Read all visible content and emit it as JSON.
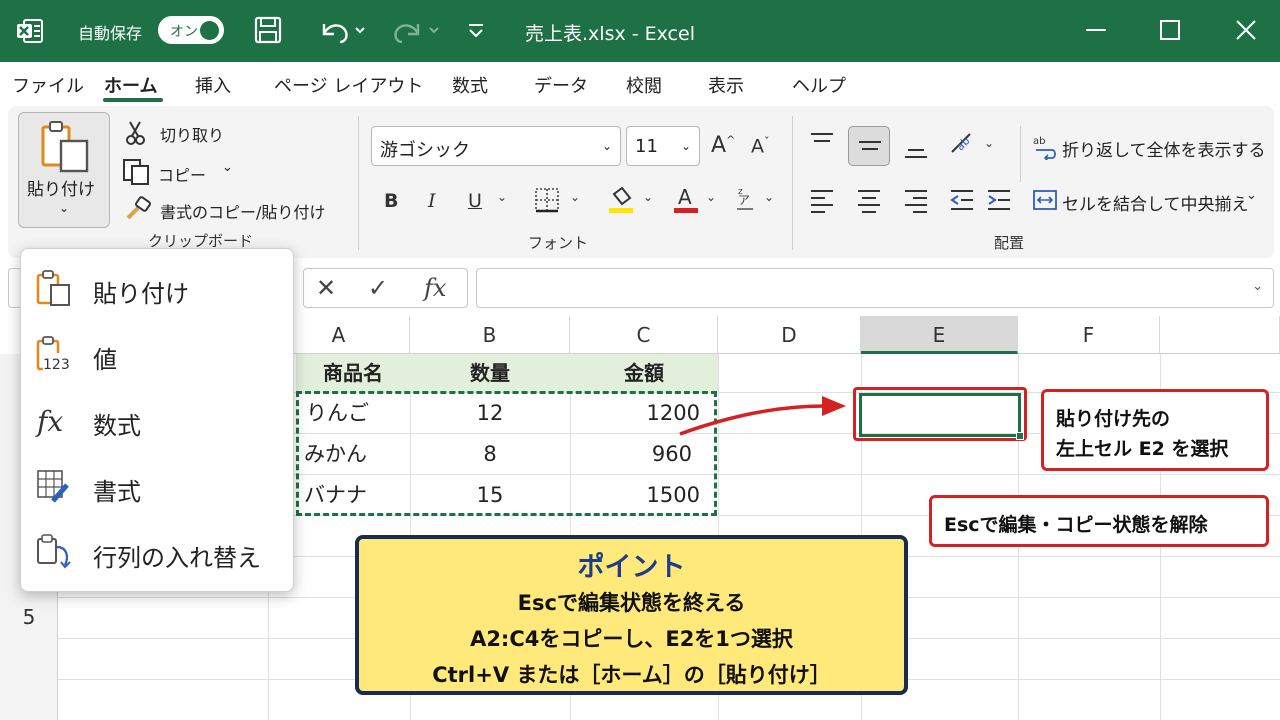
{
  "titlebar": {
    "autosave_label": "自動保存",
    "autosave_toggle": "オン",
    "document_title": "売上表.xlsx  -  Excel",
    "bg_color": "#1e7145"
  },
  "tabs": [
    "ファイル",
    "ホーム",
    "挿入",
    "ページ レイアウト",
    "数式",
    "データ",
    "校閲",
    "表示",
    "ヘルプ"
  ],
  "active_tab": "ホーム",
  "ribbon": {
    "clipboard": {
      "paste_label": "貼り付け",
      "cut_label": "切り取り",
      "copy_label": "コピー",
      "format_painter_label": "書式のコピー/貼り付け",
      "group_label": "クリップボード"
    },
    "font": {
      "font_name": "游ゴシック",
      "font_size": "11",
      "bold": "B",
      "italic": "I",
      "underline": "U",
      "grow": "A",
      "shrink": "A",
      "group_label": "フォント"
    },
    "alignment": {
      "wrap_label": "折り返して全体を表示する",
      "merge_label": "セルを結合して中央揃え",
      "group_label": "配置"
    }
  },
  "paste_menu": {
    "items": [
      {
        "label": "貼り付け",
        "icon": "paste-icon"
      },
      {
        "label": "値",
        "icon": "paste-values-icon"
      },
      {
        "label": "数式",
        "icon": "fx-icon"
      },
      {
        "label": "書式",
        "icon": "format-icon"
      },
      {
        "label": "行列の入れ替え",
        "icon": "transpose-icon"
      }
    ]
  },
  "formula_bar": {
    "fx": "fx",
    "cancel": "✕",
    "enter": "✓"
  },
  "sheet": {
    "columns": [
      "A",
      "B",
      "C",
      "D",
      "E",
      "F"
    ],
    "selected_column": "E",
    "visible_row_header": "5",
    "headers": [
      "商品名",
      "数量",
      "金額"
    ],
    "rows": [
      [
        "りんご",
        "12",
        "1200"
      ],
      [
        "みかん",
        "8",
        "960"
      ],
      [
        "バナナ",
        "15",
        "1500"
      ]
    ]
  },
  "callouts": {
    "target_line1": "貼り付け先の",
    "target_line2": "左上セル E2 を選択",
    "esc_note": "Escで編集・コピー状態を解除"
  },
  "point": {
    "title": "ポイント",
    "line1": "Escで編集状態を終える",
    "line2": "A2:C4をコピーし、E2を1つ選択",
    "line3": "Ctrl+V または［ホーム］の［貼り付け］"
  }
}
